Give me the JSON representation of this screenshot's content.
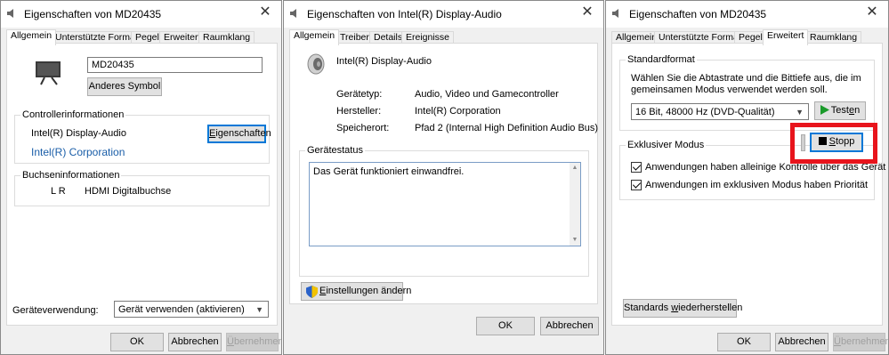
{
  "window1": {
    "title": "Eigenschaften von MD20435",
    "tabs": [
      "Allgemein",
      "Unterstützte Formate",
      "Pegel",
      "Erweitert",
      "Raumklang"
    ],
    "device_name_value": "MD20435",
    "change_icon_button": "Anderes Symbol",
    "controller_group_title": "Controllerinformationen",
    "controller_name": "Intel(R) Display-Audio",
    "properties_button_prefix": "E",
    "properties_button_rest": "igenschaften",
    "manufacturer_link": "Intel(R) Corporation",
    "jack_group_title": "Buchseninformationen",
    "jack_channels": "L R",
    "jack_type": "HDMI Digitalbuchse",
    "usage_label": "Geräteverwendung:",
    "usage_value": "Gerät verwenden (aktivieren)",
    "ok": "OK",
    "cancel": "Abbrechen",
    "apply_prefix": "Ü",
    "apply_rest": "bernehmen"
  },
  "window2": {
    "title": "Eigenschaften von Intel(R) Display-Audio",
    "tabs": [
      "Allgemein",
      "Treiber",
      "Details",
      "Ereignisse"
    ],
    "device_name": "Intel(R) Display-Audio",
    "type_label": "Gerätetyp:",
    "type_value": "Audio, Video und Gamecontroller",
    "manufacturer_label": "Hersteller:",
    "manufacturer_value": "Intel(R) Corporation",
    "location_label": "Speicherort:",
    "location_value": "Pfad 2 (Internal High Definition Audio Bus)",
    "status_group_title": "Gerätestatus",
    "status_text": "Das Gerät funktioniert einwandfrei.",
    "change_settings_prefix": "E",
    "change_settings_rest": "instellungen ändern",
    "ok": "OK",
    "cancel": "Abbrechen"
  },
  "window3": {
    "title": "Eigenschaften von MD20435",
    "tabs": [
      "Allgemein",
      "Unterstützte Formate",
      "Pegel",
      "Erweitert",
      "Raumklang"
    ],
    "default_format_title": "Standardformat",
    "default_format_desc1": "Wählen Sie die Abtastrate und die Bittiefe aus, die im",
    "default_format_desc2": "gemeinsamen Modus verwendet werden soll.",
    "format_value": "16 Bit, 48000 Hz (DVD-Qualität)",
    "test_prefix": "Test",
    "test_underline": "e",
    "test_rest": "n",
    "stop_underline": "S",
    "stop_rest": "topp",
    "exclusive_title": "Exklusiver Modus",
    "exclusive_check1": "Anwendungen haben alleinige Kontrolle über das Gerät",
    "exclusive_check2": "Anwendungen im exklusiven Modus haben Priorität",
    "restore_prefix": "Standards ",
    "restore_underline": "w",
    "restore_rest": "iederherstellen",
    "ok": "OK",
    "cancel": "Abbrechen",
    "apply_prefix": "Ü",
    "apply_rest": "bernehmen"
  },
  "colors": {
    "accent_focus": "#0078d7",
    "highlight_red": "#e8141c",
    "link_blue": "#1a5ea8",
    "play_green": "#1a9a2a"
  }
}
